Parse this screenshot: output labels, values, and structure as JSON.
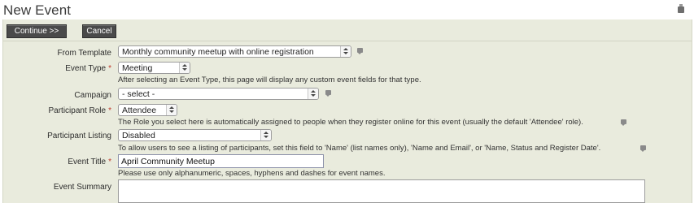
{
  "page": {
    "title": "New Event"
  },
  "buttons": {
    "continue_label": "Continue >>",
    "cancel_label": "Cancel"
  },
  "form": {
    "from_template": {
      "label": "From Template",
      "value": "Monthly community meetup with online registration"
    },
    "event_type": {
      "label": "Event Type",
      "value": "Meeting",
      "help": "After selecting an Event Type, this page will display any custom event fields for that type."
    },
    "campaign": {
      "label": "Campaign",
      "value": "- select -"
    },
    "participant_role": {
      "label": "Participant Role",
      "value": "Attendee",
      "help": "The Role you select here is automatically assigned to people when they register online for this event (usually the default 'Attendee' role)."
    },
    "participant_listing": {
      "label": "Participant Listing",
      "value": "Disabled",
      "help": "To allow users to see a listing of participants, set this field to 'Name' (list names only), 'Name and Email', or 'Name, Status and Register Date'."
    },
    "event_title": {
      "label": "Event Title",
      "value": "April Community Meetup",
      "help": "Please use only alphanumeric, spaces, hyphens and dashes for event names."
    },
    "event_summary": {
      "label": "Event Summary",
      "value": ""
    },
    "required_marker": "*"
  },
  "icons": {
    "help": "help-icon",
    "print": "print-icon"
  },
  "colors": {
    "panel_bg": "#e9ebdd",
    "button_bg": "#4a4a4a",
    "required": "#c0392b"
  }
}
